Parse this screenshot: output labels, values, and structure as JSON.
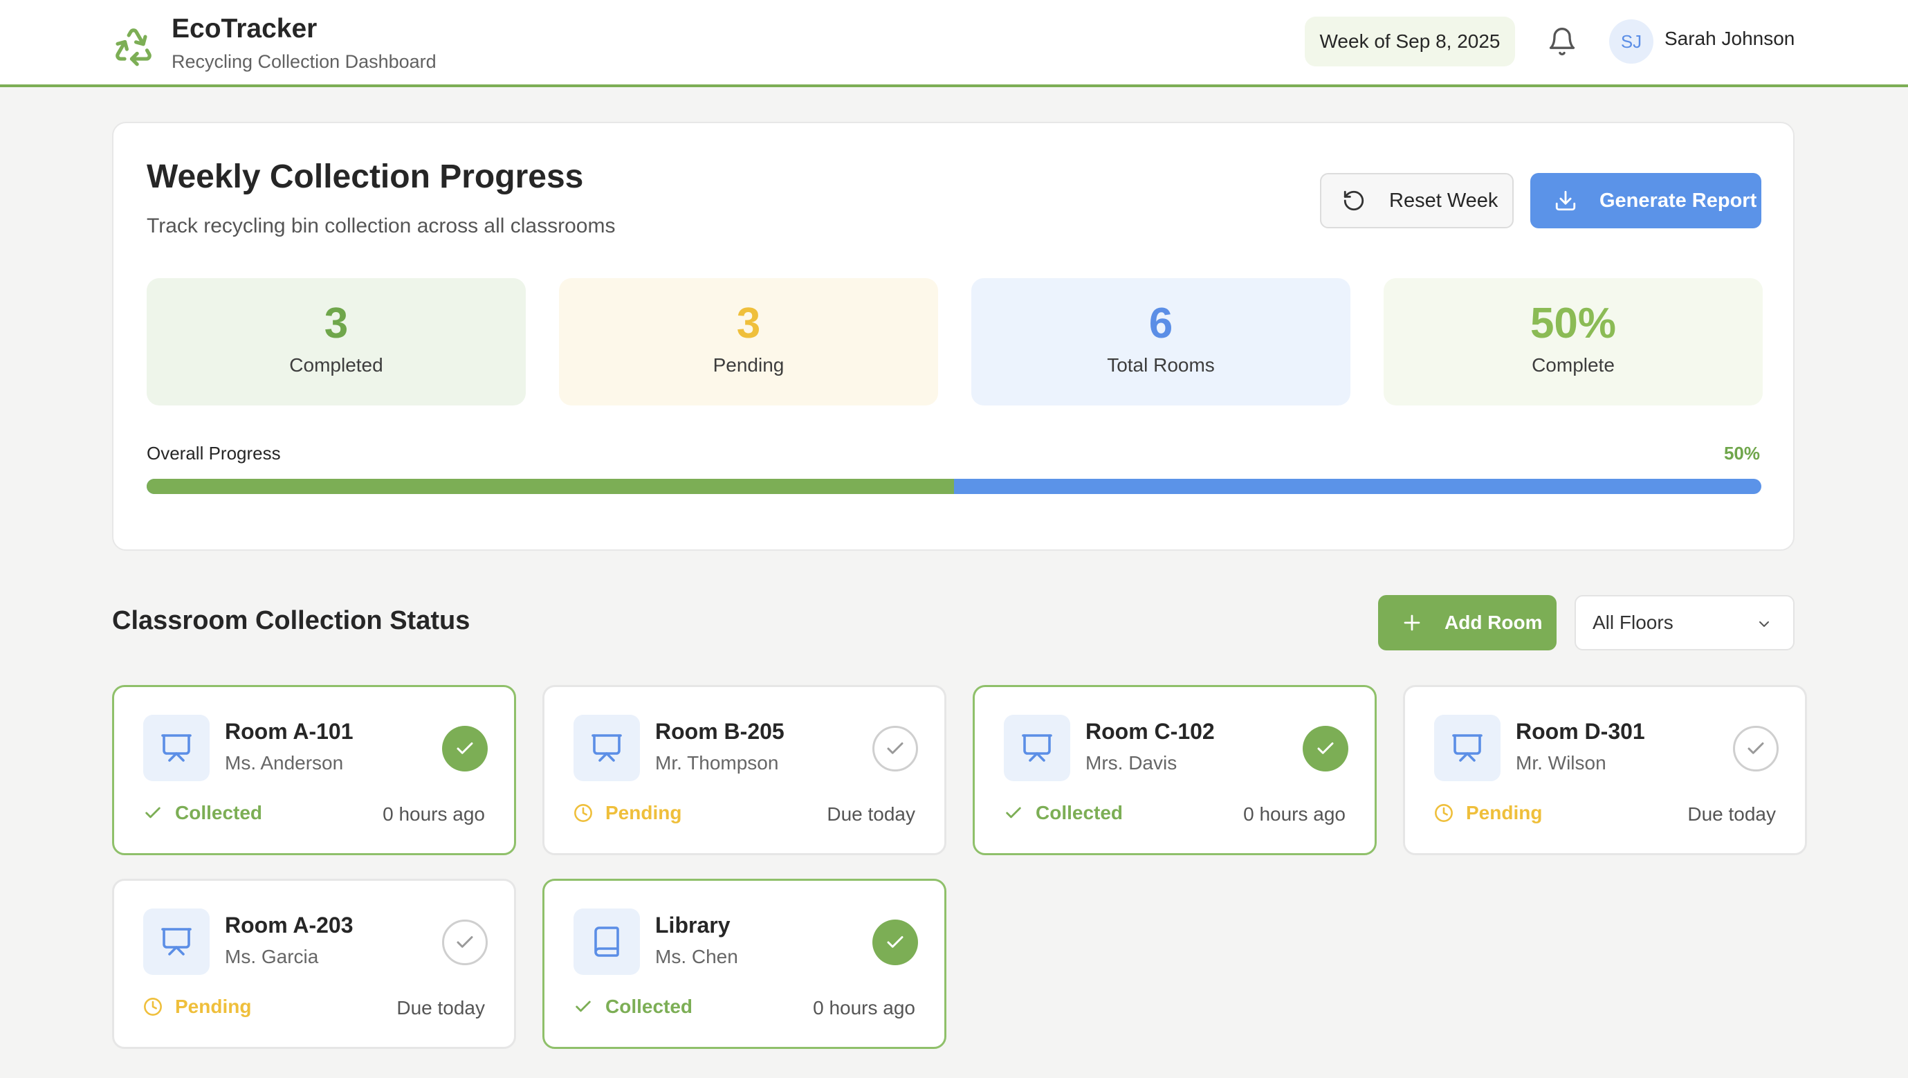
{
  "app": {
    "title": "EcoTracker",
    "subtitle": "Recycling Collection Dashboard",
    "brand_color": "#7cae55"
  },
  "header": {
    "week_label": "Week of Sep 8, 2025",
    "user": {
      "initials": "SJ",
      "name": "Sarah Johnson"
    },
    "icons": [
      "recycle-icon",
      "bell-icon"
    ]
  },
  "progress": {
    "title": "Weekly Collection Progress",
    "subtitle": "Track recycling bin collection across all classrooms",
    "reset_label": "Reset Week",
    "report_label": "Generate Report",
    "stats": [
      {
        "value": "3",
        "label": "Completed",
        "color": "#6fa64b"
      },
      {
        "value": "3",
        "label": "Pending",
        "color": "#efbf3b"
      },
      {
        "value": "6",
        "label": "Total Rooms",
        "color": "#5b8ee6"
      },
      {
        "value": "50%",
        "label": "Complete",
        "color": "#8bbb55"
      }
    ],
    "overall_label": "Overall Progress",
    "overall_pct_text": "50%",
    "overall_fraction": 0.5
  },
  "classrooms": {
    "title": "Classroom Collection Status",
    "add_label": "Add Room",
    "floor_filter": "All Floors",
    "rooms": [
      {
        "name": "Room A-101",
        "teacher": "Ms. Anderson",
        "status": "Collected",
        "when": "0 hours ago",
        "icon": "presentation-icon"
      },
      {
        "name": "Room B-205",
        "teacher": "Mr. Thompson",
        "status": "Pending",
        "when": "Due today",
        "icon": "presentation-icon"
      },
      {
        "name": "Room C-102",
        "teacher": "Mrs. Davis",
        "status": "Collected",
        "when": "0 hours ago",
        "icon": "presentation-icon"
      },
      {
        "name": "Room D-301",
        "teacher": "Mr. Wilson",
        "status": "Pending",
        "when": "Due today",
        "icon": "presentation-icon"
      },
      {
        "name": "Room A-203",
        "teacher": "Ms. Garcia",
        "status": "Pending",
        "when": "Due today",
        "icon": "presentation-icon"
      },
      {
        "name": "Library",
        "teacher": "Ms. Chen",
        "status": "Collected",
        "when": "0 hours ago",
        "icon": "book-icon"
      }
    ]
  }
}
